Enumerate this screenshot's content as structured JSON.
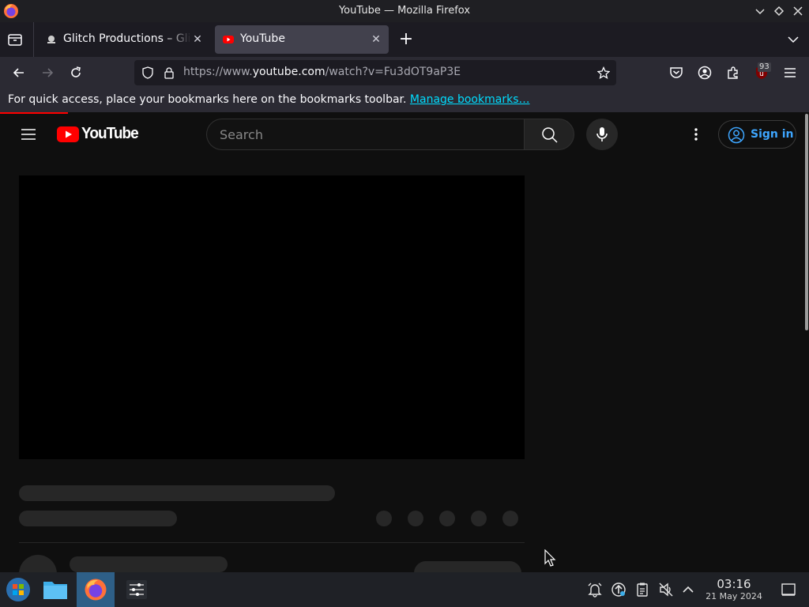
{
  "window": {
    "title": "YouTube — Mozilla Firefox"
  },
  "tabs": [
    {
      "label": "Glitch Productions – Glitch",
      "favicon": "glitch-icon",
      "active": false
    },
    {
      "label": "YouTube",
      "favicon": "youtube-icon",
      "active": true
    }
  ],
  "navbar": {
    "url_prefix": "https://www.",
    "url_domain": "youtube.com",
    "url_path": "/watch?v=Fu3dOT9aP3E",
    "extension_badge": "93"
  },
  "bookmarks_bar": {
    "message": "For quick access, place your bookmarks here on the bookmarks toolbar.",
    "link_text": "Manage bookmarks…"
  },
  "youtube": {
    "logo_text": "YouTube",
    "search_placeholder": "Search",
    "signin_label": "Sign in",
    "accent_color": "#ff0000",
    "link_color": "#3ea6ff"
  },
  "taskbar": {
    "time": "03:16",
    "date": "21 May 2024"
  }
}
